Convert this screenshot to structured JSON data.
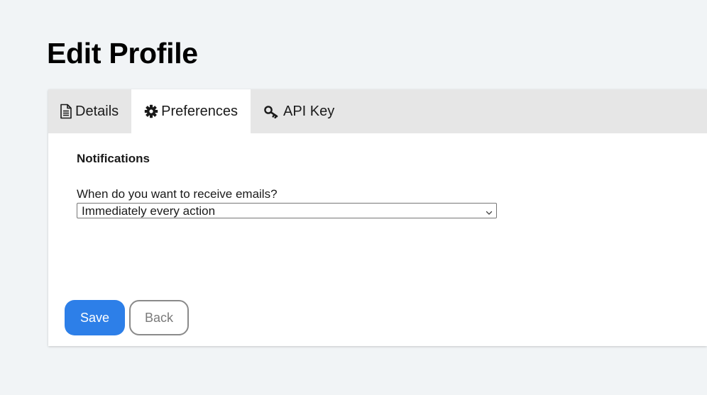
{
  "page": {
    "title": "Edit Profile"
  },
  "tabs": [
    {
      "label": "Details",
      "icon": "document-icon",
      "active": false
    },
    {
      "label": "Preferences",
      "icon": "gear-icon",
      "active": true
    },
    {
      "label": "API Key",
      "icon": "key-icon",
      "active": false
    }
  ],
  "preferences": {
    "section_title": "Notifications",
    "email_question": "When do you want to receive emails?",
    "email_frequency_selected": "Immediately every action"
  },
  "actions": {
    "save_label": "Save",
    "back_label": "Back"
  },
  "colors": {
    "page_background": "#f1f4f6",
    "tabbar_background": "#e6e6e6",
    "save_button": "#2d7fe8"
  }
}
